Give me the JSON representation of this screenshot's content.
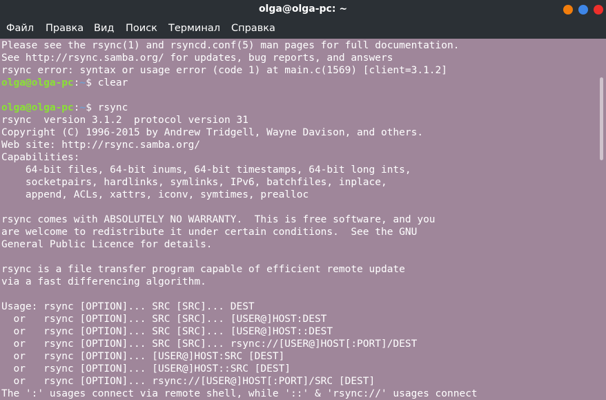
{
  "window": {
    "title": "olga@olga-pc: ~",
    "buttons": [
      "minimize",
      "maximize",
      "close"
    ],
    "colors": {
      "minimize": "#f27d0c",
      "maximize": "#3e86e8",
      "close": "#ee2f2b"
    }
  },
  "menu": {
    "items": [
      {
        "label": "Файл"
      },
      {
        "label": "Правка"
      },
      {
        "label": "Вид"
      },
      {
        "label": "Поиск"
      },
      {
        "label": "Терминал"
      },
      {
        "label": "Справка"
      }
    ]
  },
  "prompt": {
    "user": "olga@olga-pc",
    "sep": ":",
    "path": "~",
    "symbol": "$ "
  },
  "colors": {
    "background": "#9f869a",
    "text": "#ffffff",
    "prompt_user": "#8ae234",
    "prompt_path": "#729fcf",
    "chrome": "#2b3035"
  },
  "terminal_lines": [
    {
      "type": "text",
      "text": "Please see the rsync(1) and rsyncd.conf(5) man pages for full documentation."
    },
    {
      "type": "text",
      "text": "See http://rsync.samba.org/ for updates, bug reports, and answers"
    },
    {
      "type": "text",
      "text": "rsync error: syntax or usage error (code 1) at main.c(1569) [client=3.1.2]"
    },
    {
      "type": "prompt",
      "command": "clear"
    },
    {
      "type": "text",
      "text": ""
    },
    {
      "type": "prompt",
      "command": "rsync"
    },
    {
      "type": "text",
      "text": "rsync  version 3.1.2  protocol version 31"
    },
    {
      "type": "text",
      "text": "Copyright (C) 1996-2015 by Andrew Tridgell, Wayne Davison, and others."
    },
    {
      "type": "text",
      "text": "Web site: http://rsync.samba.org/"
    },
    {
      "type": "text",
      "text": "Capabilities:"
    },
    {
      "type": "text",
      "text": "    64-bit files, 64-bit inums, 64-bit timestamps, 64-bit long ints,"
    },
    {
      "type": "text",
      "text": "    socketpairs, hardlinks, symlinks, IPv6, batchfiles, inplace,"
    },
    {
      "type": "text",
      "text": "    append, ACLs, xattrs, iconv, symtimes, prealloc"
    },
    {
      "type": "text",
      "text": ""
    },
    {
      "type": "text",
      "text": "rsync comes with ABSOLUTELY NO WARRANTY.  This is free software, and you"
    },
    {
      "type": "text",
      "text": "are welcome to redistribute it under certain conditions.  See the GNU"
    },
    {
      "type": "text",
      "text": "General Public Licence for details."
    },
    {
      "type": "text",
      "text": ""
    },
    {
      "type": "text",
      "text": "rsync is a file transfer program capable of efficient remote update"
    },
    {
      "type": "text",
      "text": "via a fast differencing algorithm."
    },
    {
      "type": "text",
      "text": ""
    },
    {
      "type": "text",
      "text": "Usage: rsync [OPTION]... SRC [SRC]... DEST"
    },
    {
      "type": "text",
      "text": "  or   rsync [OPTION]... SRC [SRC]... [USER@]HOST:DEST"
    },
    {
      "type": "text",
      "text": "  or   rsync [OPTION]... SRC [SRC]... [USER@]HOST::DEST"
    },
    {
      "type": "text",
      "text": "  or   rsync [OPTION]... SRC [SRC]... rsync://[USER@]HOST[:PORT]/DEST"
    },
    {
      "type": "text",
      "text": "  or   rsync [OPTION]... [USER@]HOST:SRC [DEST]"
    },
    {
      "type": "text",
      "text": "  or   rsync [OPTION]... [USER@]HOST::SRC [DEST]"
    },
    {
      "type": "text",
      "text": "  or   rsync [OPTION]... rsync://[USER@]HOST[:PORT]/SRC [DEST]"
    },
    {
      "type": "text",
      "text": "The ':' usages connect via remote shell, while '::' & 'rsync://' usages connect"
    }
  ]
}
